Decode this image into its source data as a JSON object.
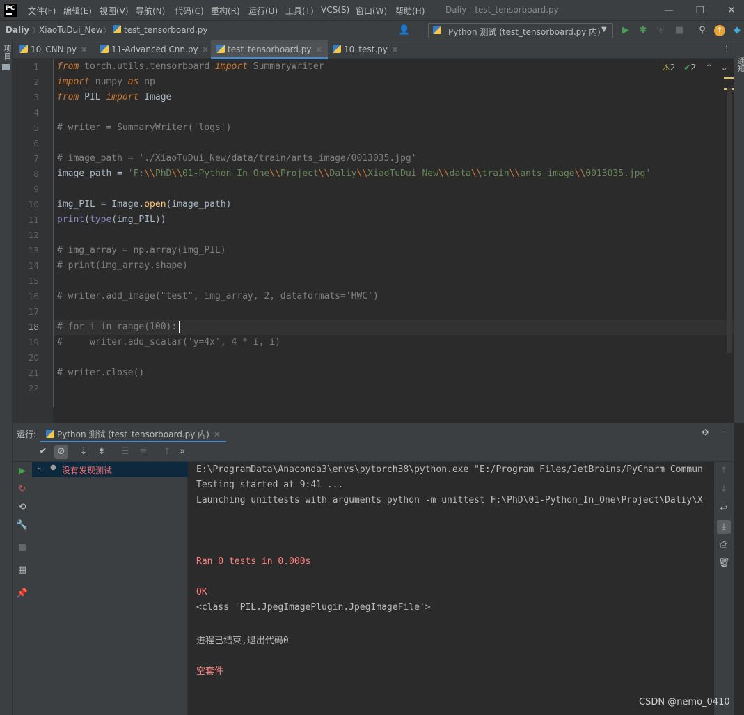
{
  "titlebar": {
    "logo": "PC",
    "menu": [
      "文件(F)",
      "编辑(E)",
      "视图(V)",
      "导航(N)",
      "代码(C)",
      "重构(R)",
      "运行(U)",
      "工具(T)",
      "VCS(S)",
      "窗口(W)",
      "帮助(H)"
    ],
    "window_title": "Daliy - test_tensorboard.py",
    "min": "—",
    "max": "❐",
    "close": "✕"
  },
  "navbar": {
    "crumbs": [
      "Daliy",
      "XiaoTuDui_New",
      "test_tensorboard.py"
    ],
    "run_config": "Python 测试 (test_tensorboard.py 内)"
  },
  "left_strip_label": "项目",
  "right_strip_label": "通知",
  "tabs": [
    {
      "label": "10_CNN.py",
      "active": false
    },
    {
      "label": "11-Advanced Cnn.py",
      "active": false
    },
    {
      "label": "test_tensorboard.py",
      "active": true
    },
    {
      "label": "10_test.py",
      "active": false
    }
  ],
  "inspections": {
    "warnings": "2",
    "weak_warnings": "2"
  },
  "editor": {
    "line_numbers": [
      "1",
      "2",
      "3",
      "4",
      "5",
      "6",
      "7",
      "8",
      "9",
      "10",
      "11",
      "12",
      "13",
      "14",
      "15",
      "16",
      "17",
      "18",
      "19",
      "20",
      "21",
      "22"
    ],
    "current_line": "18"
  },
  "run_panel": {
    "label": "运行:",
    "tab": "Python 测试 (test_tensorboard.py 内)",
    "tree_item": "没有发现测试",
    "console": [
      {
        "text": "E:\\ProgramData\\Anaconda3\\envs\\pytorch38\\python.exe \"E:/Program Files/JetBrains/PyCharm Commun",
        "color": "#bbbbbb"
      },
      {
        "text": "Testing started at 9:41 ...",
        "color": "#bbbbbb"
      },
      {
        "text": "Launching unittests with arguments python -m unittest F:\\PhD\\01-Python_In_One\\Project\\Daliy\\X",
        "color": "#bbbbbb"
      },
      {
        "text": "",
        "color": "#bbbbbb"
      },
      {
        "text": "",
        "color": "#bbbbbb"
      },
      {
        "text": "",
        "color": "#bbbbbb"
      },
      {
        "text": "Ran 0 tests in 0.000s",
        "color": "#ff8080"
      },
      {
        "text": "",
        "color": "#bbbbbb"
      },
      {
        "text": "OK",
        "color": "#ff8080"
      },
      {
        "text": "<class 'PIL.JpegImagePlugin.JpegImageFile'>",
        "color": "#bbbbbb"
      },
      {
        "text": "",
        "color": "#bbbbbb"
      },
      {
        "text": "进程已结束,退出代码0",
        "color": "#bbbbbb"
      },
      {
        "text": "",
        "color": "#bbbbbb"
      },
      {
        "text": "空套件",
        "color": "#ff8080"
      }
    ]
  },
  "watermark": "CSDN @nemo_0410",
  "colors": {
    "accent": "#4a88c7",
    "run_green": "#499c54",
    "error_red": "#ff8080"
  }
}
